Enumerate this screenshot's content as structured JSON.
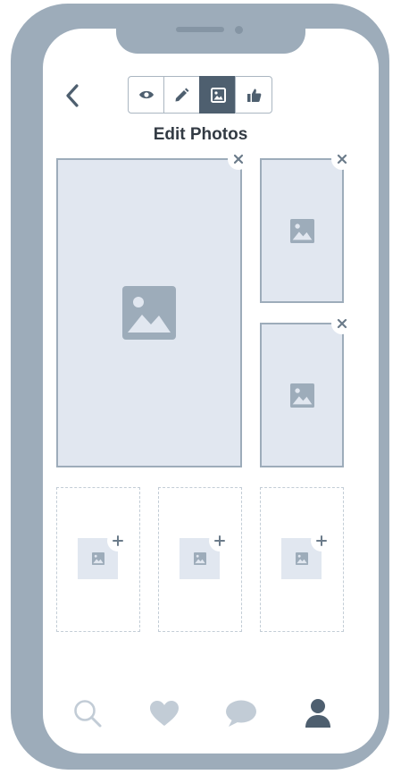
{
  "header": {
    "back": "chevron-left-icon",
    "title": "Edit Photos"
  },
  "mode_tabs": [
    {
      "icon": "eye-icon",
      "active": false
    },
    {
      "icon": "pencil-icon",
      "active": false
    },
    {
      "icon": "image-icon",
      "active": true
    },
    {
      "icon": "thumbs-up-icon",
      "active": false
    }
  ],
  "photos": {
    "filled_count": 3,
    "empty_slot_count": 3,
    "remove_icon": "close-icon",
    "add_icon": "plus-icon"
  },
  "bottom_nav": [
    {
      "icon": "search-icon",
      "active": false
    },
    {
      "icon": "heart-icon",
      "active": false
    },
    {
      "icon": "chat-bubble-icon",
      "active": false
    },
    {
      "icon": "user-icon",
      "active": true
    }
  ],
  "colors": {
    "frame": "#9dacba",
    "active": "#4e5f6f",
    "placeholder_bg": "#e1e7f0",
    "placeholder_icon": "#9dacba",
    "nav_inactive": "#c2ccd6"
  }
}
